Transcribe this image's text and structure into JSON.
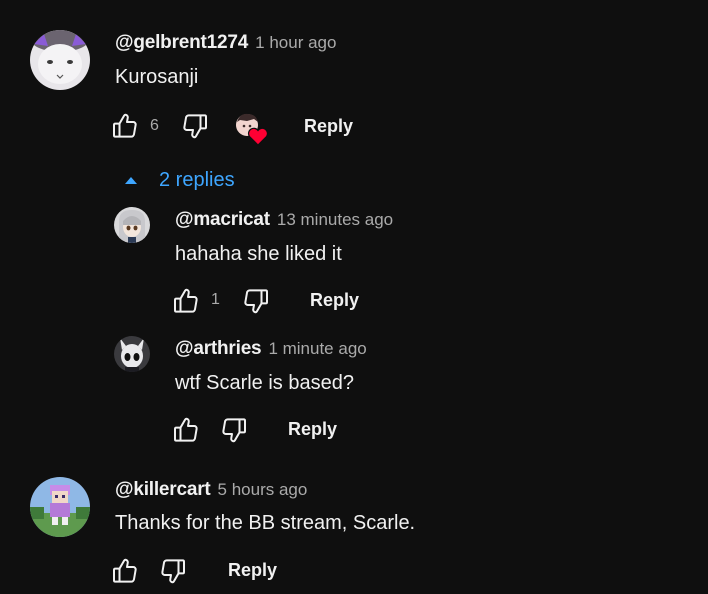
{
  "comments": [
    {
      "handle": "@gelbrent1274",
      "time": "1 hour ago",
      "text": "Kurosanji",
      "like_count": "6",
      "reply_label": "Reply",
      "has_creator_heart": true
    },
    {
      "handle": "@killercart",
      "time": "5 hours ago",
      "text": "Thanks for the BB stream, Scarle.",
      "reply_label": "Reply"
    }
  ],
  "replies_toggle": {
    "label": "2 replies",
    "expanded": true
  },
  "replies": [
    {
      "handle": "@macricat",
      "time": "13 minutes ago",
      "text": "hahaha she liked it",
      "like_count": "1",
      "reply_label": "Reply"
    },
    {
      "handle": "@arthries",
      "time": "1 minute ago",
      "text": "wtf Scarle is based?",
      "reply_label": "Reply"
    }
  ],
  "icons": {
    "like": "thumbs-up-icon",
    "dislike": "thumbs-down-icon",
    "creator_heart": "creator-heart-icon",
    "collapse": "caret-up-icon"
  },
  "colors": {
    "background": "#0f0f0f",
    "text_primary": "#f1f1f1",
    "text_secondary": "#aaaaaa",
    "link_blue": "#3ea6ff",
    "heart_red": "#ff0033"
  }
}
